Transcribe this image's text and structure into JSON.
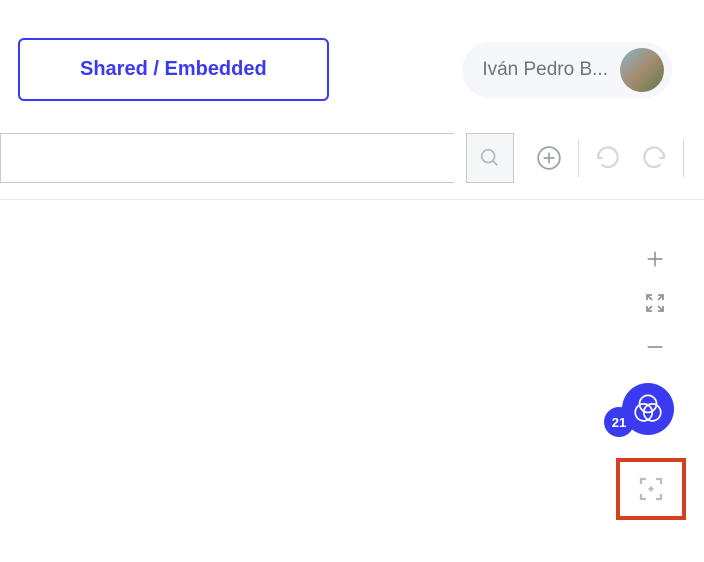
{
  "header": {
    "shared_btn_label": "Shared / Embedded",
    "user_name": "Iván Pedro B..."
  },
  "toolbar": {
    "search_value": ""
  },
  "venn": {
    "count": "21"
  }
}
